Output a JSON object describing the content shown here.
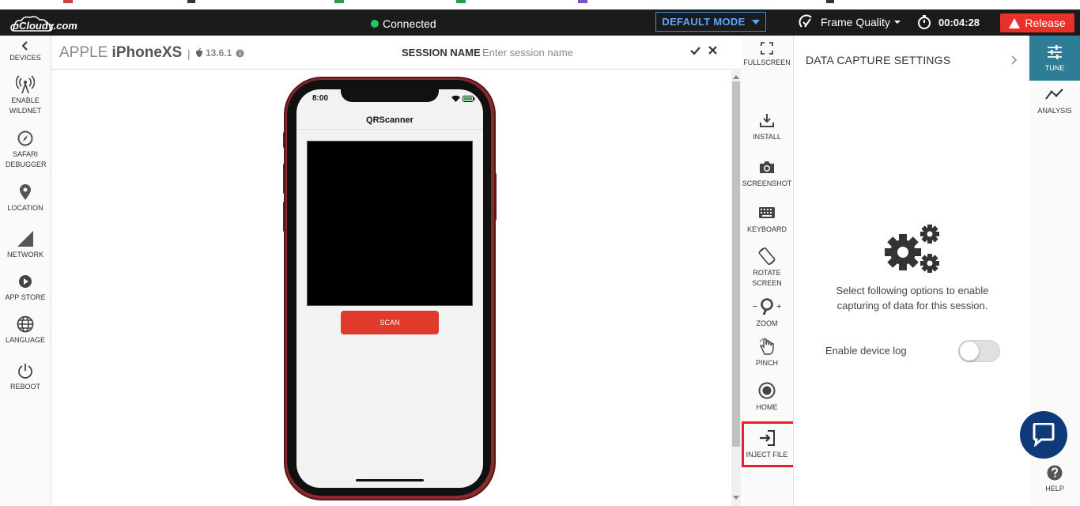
{
  "app": {
    "logo_text": "pCloudy.com"
  },
  "topbar": {
    "status": "Connected",
    "mode_label": "DEFAULT MODE",
    "frame_quality_label": "Frame Quality",
    "timer": "00:04:28",
    "release_label": "Release"
  },
  "left_sidebar": {
    "items": [
      {
        "label": "DEVICES",
        "icon": "chevron-left-icon"
      },
      {
        "label": "ENABLE WILDNET",
        "icon": "antenna-icon"
      },
      {
        "label": "SAFARI DEBUGGER",
        "icon": "compass-icon"
      },
      {
        "label": "LOCATION",
        "icon": "map-pin-icon"
      },
      {
        "label": "NETWORK",
        "icon": "signal-icon"
      },
      {
        "label": "APP STORE",
        "icon": "play-icon"
      },
      {
        "label": "LANGUAGE",
        "icon": "globe-icon"
      },
      {
        "label": "REBOOT",
        "icon": "power-icon"
      }
    ]
  },
  "device_header": {
    "brand": "APPLE",
    "model": "iPhoneXS",
    "separator": "|",
    "os_version": "13.6.1",
    "session_label": "SESSION NAME",
    "session_placeholder": "Enter session name"
  },
  "phone": {
    "time": "8:00",
    "app_title": "QRScanner",
    "scan_button": "SCAN"
  },
  "tools": {
    "items": [
      {
        "label": "FULLSCREEN",
        "icon": "fullscreen-icon"
      },
      {
        "label": "INSTALL",
        "icon": "download-icon"
      },
      {
        "label": "SCREENSHOT",
        "icon": "camera-icon"
      },
      {
        "label": "KEYBOARD",
        "icon": "keyboard-icon"
      },
      {
        "label": "ROTATE SCREEN",
        "icon": "rotate-icon"
      },
      {
        "label": "ZOOM",
        "icon": "magnifier-icon",
        "minus": "−",
        "plus": "+"
      },
      {
        "label": "PINCH",
        "icon": "hand-icon"
      },
      {
        "label": "HOME",
        "icon": "home-circle-icon"
      },
      {
        "label": "INJECT FILE",
        "icon": "sign-in-icon"
      }
    ],
    "highlight_color": "#e8202a"
  },
  "panel": {
    "title": "DATA CAPTURE SETTINGS",
    "description": "Select following options to enable capturing of data for this session.",
    "device_log_label": "Enable device log",
    "device_log_enabled": false
  },
  "right_sidebar": {
    "items": [
      {
        "label": "TUNE",
        "icon": "sliders-icon",
        "active": true
      },
      {
        "label": "ANALYSIS",
        "icon": "trend-icon",
        "active": false
      }
    ],
    "help_label": "HELP"
  },
  "colors": {
    "accent": "#2e7d97",
    "release": "#e8312a",
    "connected": "#22c55e",
    "mode_border": "#3d8cdf"
  }
}
